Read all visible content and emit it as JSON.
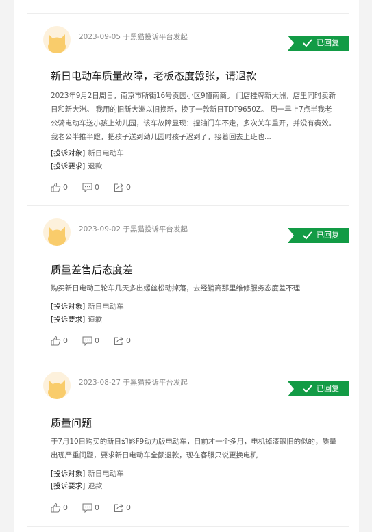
{
  "complaints": [
    {
      "meta": "2023-09-05 于黑猫投诉平台发起",
      "status": "已回复",
      "title": "新日电动车质量故障，老板态度嚣张，请退款",
      "content_lines": [
        "2023年9月2日周日，南京市所街16号贡园小区9幢南商。 门店挂牌新大洲，店里同时卖新",
        "日和新大洲。 我用的旧新大洲以旧换新，换了一款新日TDT9650Z。 周一早上7点半我老",
        "公骑电动车送小孩上幼儿园，该车故障显现：捏油门车不走，多次关车重开，并没有奏效。",
        "我老公半推半蹬，把孩子送到幼儿园时孩子迟到了，接着回去上班也..."
      ],
      "target_label": "[投诉对象]",
      "target_value": "新日电动车",
      "demand_label": "[投诉要求]",
      "demand_value": "退款",
      "likes": "0",
      "comments": "0",
      "shares": "0"
    },
    {
      "meta": "2023-09-02 于黑猫投诉平台发起",
      "status": "已回复",
      "title": "质量差售后态度差",
      "content_lines": [
        "购买新日电动三轮车几天多出螺丝松动掉落，去经销商那里维修服务态度差不理"
      ],
      "target_label": "[投诉对象]",
      "target_value": "新日电动车",
      "demand_label": "[投诉要求]",
      "demand_value": "道歉",
      "likes": "0",
      "comments": "0",
      "shares": "0"
    },
    {
      "meta": "2023-08-27 于黑猫投诉平台发起",
      "status": "已回复",
      "title": "质量问题",
      "content_lines": [
        "于7月10日购买的新日幻影F9动力版电动车，目前才一个多月，电机掉漆眼旧的似的，质量",
        "出现严重问题，要求新日电动车全额退款，现在客服只说更换电机"
      ],
      "target_label": "[投诉对象]",
      "target_value": "新日电动车",
      "demand_label": "[投诉要求]",
      "demand_value": "退款",
      "likes": "0",
      "comments": "0",
      "shares": "0"
    }
  ],
  "icons": {
    "avatar": "cat-avatar-icon",
    "status": "check-icon",
    "like": "thumbs-up-icon",
    "comment": "comment-icon",
    "share": "share-icon"
  },
  "colors": {
    "status_badge": "#129b45",
    "avatar_bg": "#fdf1dc",
    "avatar_cat": "#f9cc6b"
  }
}
